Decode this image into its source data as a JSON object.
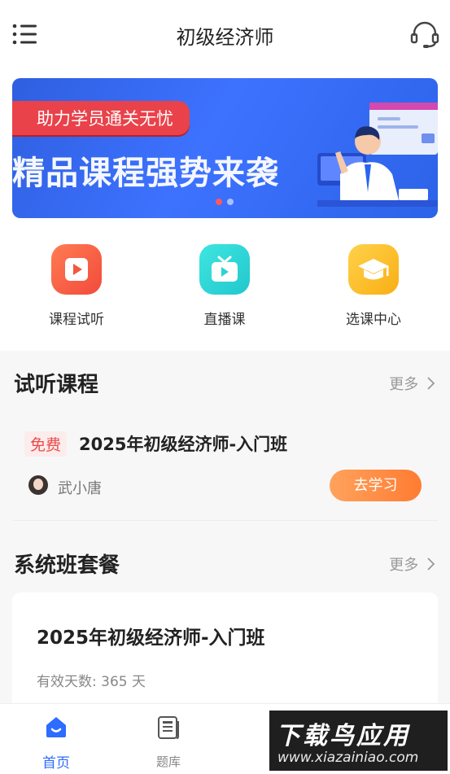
{
  "header": {
    "title": "初级经济师",
    "menu_icon": "menu-list-icon",
    "service_icon": "headset-icon"
  },
  "banner": {
    "subtitle": "助力学员通关无忧",
    "headline": "精品课程强势来袭",
    "slide_count": 2,
    "active_slide": 1,
    "colors": {
      "bg": "#3d72ff",
      "tag": "#e9424a"
    }
  },
  "quick_entries": [
    {
      "label": "课程试听",
      "icon": "play-video-icon",
      "color": "#f24a3c"
    },
    {
      "label": "直播课",
      "icon": "tv-icon",
      "color": "#22c7cd"
    },
    {
      "label": "选课中心",
      "icon": "graduation-cap-icon",
      "color": "#f9ae14"
    }
  ],
  "trial_section": {
    "title": "试听课程",
    "more": "更多",
    "course": {
      "tag": "免费",
      "title": "2025年初级经济师-入门班",
      "teacher": "武小唐",
      "button": "去学习"
    }
  },
  "package_section": {
    "title": "系统班套餐",
    "more": "更多",
    "package": {
      "title": "2025年初级经济师-入门班",
      "valid_days": "有效天数: 365 天"
    }
  },
  "tabbar": {
    "items": [
      {
        "label": "首页",
        "icon": "home-icon",
        "active": true
      },
      {
        "label": "题库",
        "icon": "question-bank-icon",
        "active": false
      }
    ],
    "accent": "#2d6cff"
  },
  "watermark": {
    "line1": "下载鸟应用",
    "line2": "www.xiazainiao.com"
  }
}
